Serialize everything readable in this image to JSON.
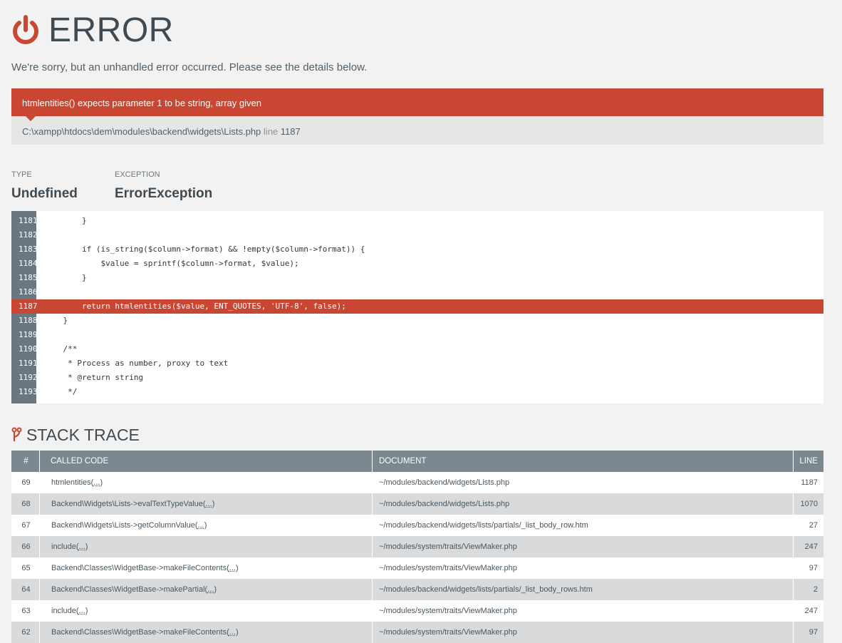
{
  "header": {
    "title": "ERROR",
    "subtitle": "We're sorry, but an unhandled error occurred. Please see the details below."
  },
  "error": {
    "message": "htmlentities() expects parameter 1 to be string, array given",
    "file": "C:\\xampp\\htdocs\\dem\\modules\\backend\\widgets\\Lists.php",
    "line_label": "line",
    "line_number": "1187"
  },
  "meta": {
    "type_label": "TYPE",
    "type_value": "Undefined",
    "exception_label": "EXCEPTION",
    "exception_value": "ErrorException"
  },
  "code": {
    "lines": [
      {
        "num": "1181",
        "text": "        }"
      },
      {
        "num": "1182",
        "text": ""
      },
      {
        "num": "1183",
        "text": "        if (is_string($column->format) && !empty($column->format)) {"
      },
      {
        "num": "1184",
        "text": "            $value = sprintf($column->format, $value);"
      },
      {
        "num": "1185",
        "text": "        }"
      },
      {
        "num": "1186",
        "text": ""
      },
      {
        "num": "1187",
        "text": "        return htmlentities($value, ENT_QUOTES, 'UTF-8', false);"
      },
      {
        "num": "1188",
        "text": "    }"
      },
      {
        "num": "1189",
        "text": ""
      },
      {
        "num": "1190",
        "text": "    /**"
      },
      {
        "num": "1191",
        "text": "     * Process as number, proxy to text"
      },
      {
        "num": "1192",
        "text": "     * @return string"
      },
      {
        "num": "1193",
        "text": "     */"
      }
    ],
    "highlight": "1187"
  },
  "stack": {
    "title": "STACK TRACE",
    "headers": {
      "num": "#",
      "code": "CALLED CODE",
      "doc": "DOCUMENT",
      "line": "LINE"
    },
    "rows": [
      {
        "num": "69",
        "code": "htmlentities(",
        "args": "...",
        "close": ")",
        "doc": "~/modules/backend/widgets/Lists.php",
        "line": "1187"
      },
      {
        "num": "68",
        "code": "Backend\\Widgets\\Lists->evalTextTypeValue(",
        "args": "...",
        "close": ")",
        "doc": "~/modules/backend/widgets/Lists.php",
        "line": "1070"
      },
      {
        "num": "67",
        "code": "Backend\\Widgets\\Lists->getColumnValue(",
        "args": "...",
        "close": ")",
        "doc": "~/modules/backend/widgets/lists/partials/_list_body_row.htm",
        "line": "27"
      },
      {
        "num": "66",
        "code": "include(",
        "args": "...",
        "close": ")",
        "doc": "~/modules/system/traits/ViewMaker.php",
        "line": "247"
      },
      {
        "num": "65",
        "code": "Backend\\Classes\\WidgetBase->makeFileContents(",
        "args": "...",
        "close": ")",
        "doc": "~/modules/system/traits/ViewMaker.php",
        "line": "97"
      },
      {
        "num": "64",
        "code": "Backend\\Classes\\WidgetBase->makePartial(",
        "args": "...",
        "close": ")",
        "doc": "~/modules/backend/widgets/lists/partials/_list_body_rows.htm",
        "line": "2"
      },
      {
        "num": "63",
        "code": "include(",
        "args": "...",
        "close": ")",
        "doc": "~/modules/system/traits/ViewMaker.php",
        "line": "247"
      },
      {
        "num": "62",
        "code": "Backend\\Classes\\WidgetBase->makeFileContents(",
        "args": "...",
        "close": ")",
        "doc": "~/modules/system/traits/ViewMaker.php",
        "line": "97"
      }
    ]
  },
  "colors": {
    "accent": "#c84632",
    "header_bg": "#7c8890",
    "gutter": "#6b7780"
  }
}
